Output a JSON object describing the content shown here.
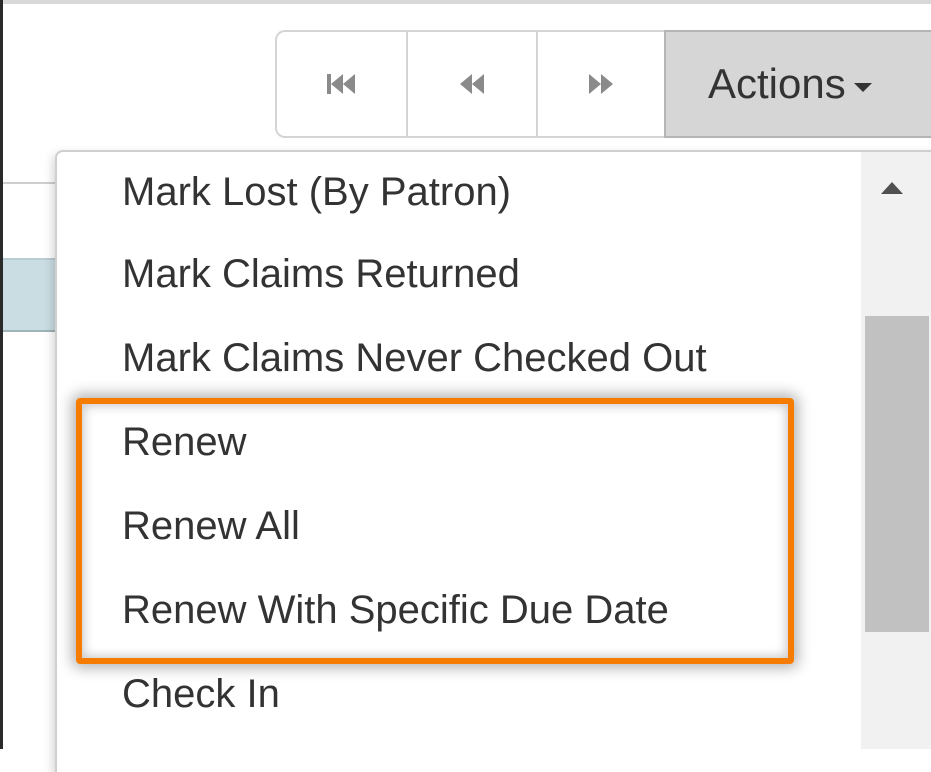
{
  "toolbar": {
    "first_icon": "first-page-icon",
    "prev_icon": "previous-page-icon",
    "next_icon": "next-page-icon",
    "actions_label": "Actions"
  },
  "menu": {
    "items": [
      {
        "label": "Mark Lost (By Patron)"
      },
      {
        "label": "Mark Claims Returned"
      },
      {
        "label": "Mark Claims Never Checked Out"
      },
      {
        "label": "Renew"
      },
      {
        "label": "Renew All"
      },
      {
        "label": "Renew With Specific Due Date"
      },
      {
        "label": "Check In"
      }
    ],
    "highlighted_items": [
      "Renew",
      "Renew All",
      "Renew With Specific Due Date"
    ]
  },
  "colors": {
    "highlight_border": "#f57c00",
    "actions_button_bg": "#d6d6d6",
    "row_highlight": "#c9dde3"
  }
}
